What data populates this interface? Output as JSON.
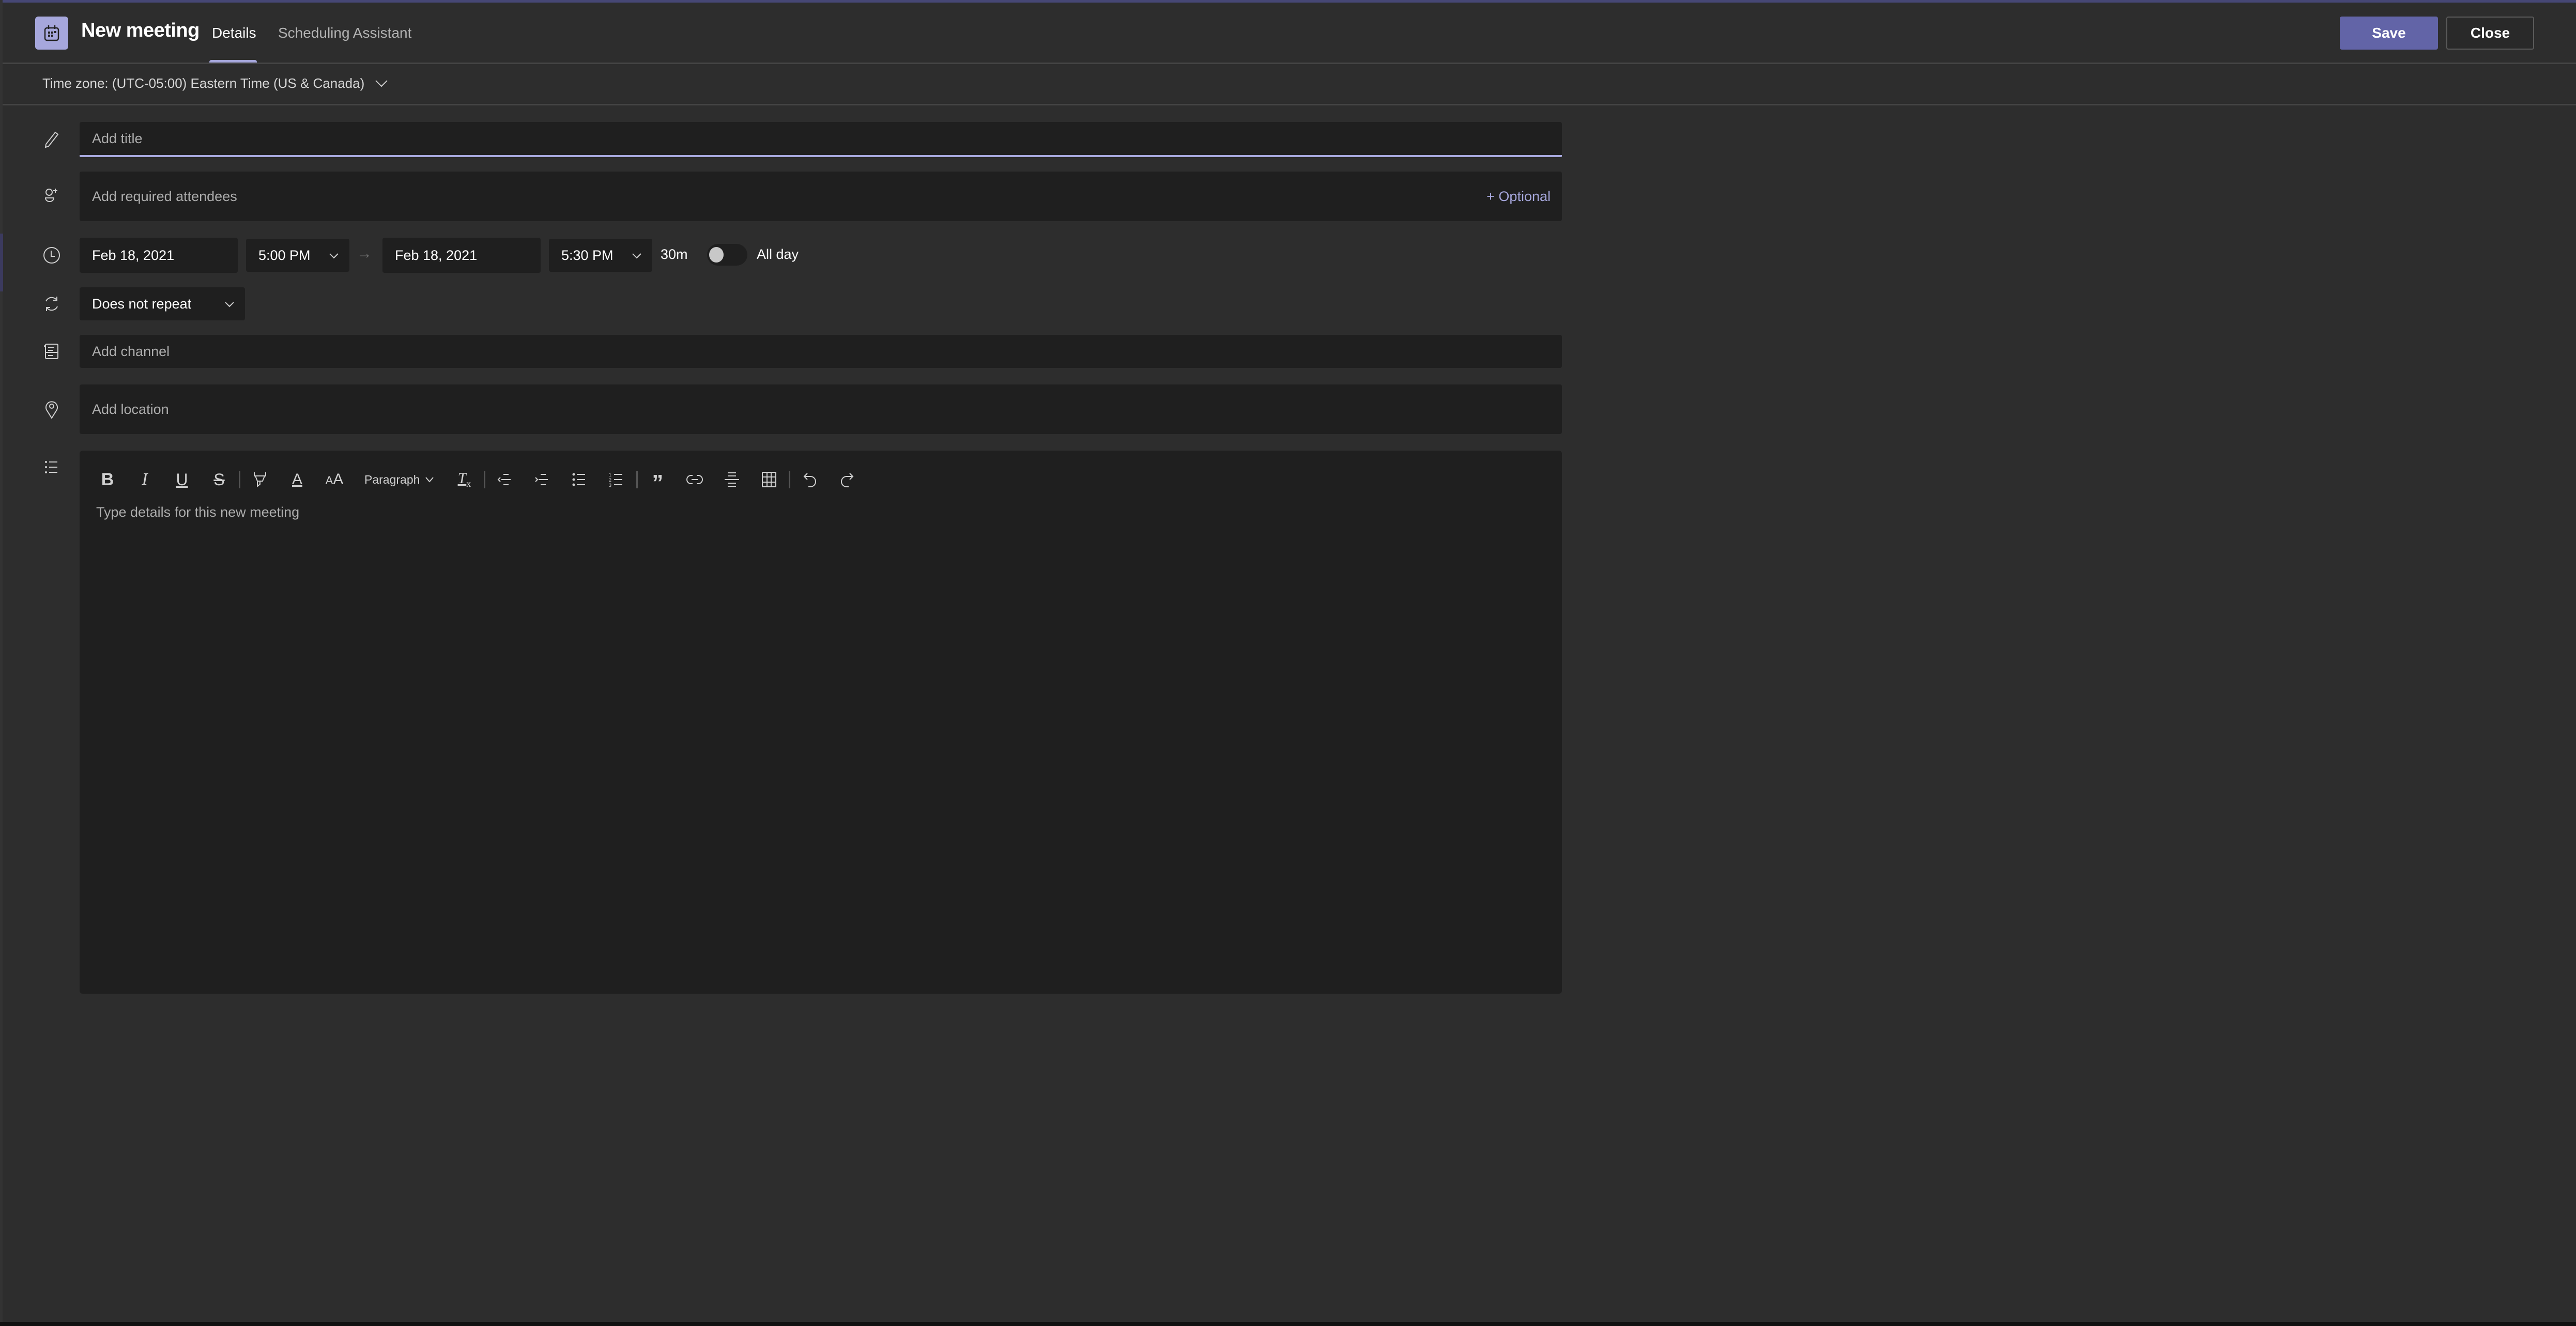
{
  "window": {
    "app_icon": "calendar-icon",
    "title": "New meeting",
    "tabs": [
      {
        "label": "Details",
        "active": true
      },
      {
        "label": "Scheduling Assistant",
        "active": false
      }
    ],
    "accent_color": "#6264a7",
    "accent_light": "#a6a7dc"
  },
  "header": {
    "save_label": "Save",
    "close_label": "Close"
  },
  "timezone": {
    "label": "Time zone: (UTC-05:00) Eastern Time (US & Canada)"
  },
  "form": {
    "title": {
      "placeholder": "Add title",
      "value": "",
      "icon": "pencil-icon"
    },
    "attendees": {
      "placeholder": "Add required attendees",
      "optional_label": "+ Optional",
      "icon": "person-add-icon"
    },
    "schedule": {
      "icon": "clock-icon",
      "start_date": "Feb 18, 2021",
      "start_time": "5:00 PM",
      "arrow": "→",
      "end_date": "Feb 18, 2021",
      "end_time": "5:30 PM",
      "duration": "30m",
      "all_day_label": "All day",
      "all_day_on": false
    },
    "recurrence": {
      "value": "Does not repeat",
      "icon": "repeat-icon"
    },
    "channel": {
      "placeholder": "Add channel",
      "icon": "channel-icon"
    },
    "location": {
      "placeholder": "Add location",
      "icon": "location-pin-icon"
    },
    "details": {
      "icon": "list-icon",
      "placeholder": "Type details for this new meeting",
      "paragraph_style": "Paragraph",
      "toolbar": [
        "bold",
        "italic",
        "underline",
        "strikethrough",
        "highlight",
        "font-color",
        "font-size",
        "paragraph",
        "clear-formatting",
        "decrease-indent",
        "increase-indent",
        "bulleted-list",
        "numbered-list",
        "quote",
        "link",
        "horizontal-rule",
        "table",
        "undo",
        "redo"
      ]
    }
  }
}
